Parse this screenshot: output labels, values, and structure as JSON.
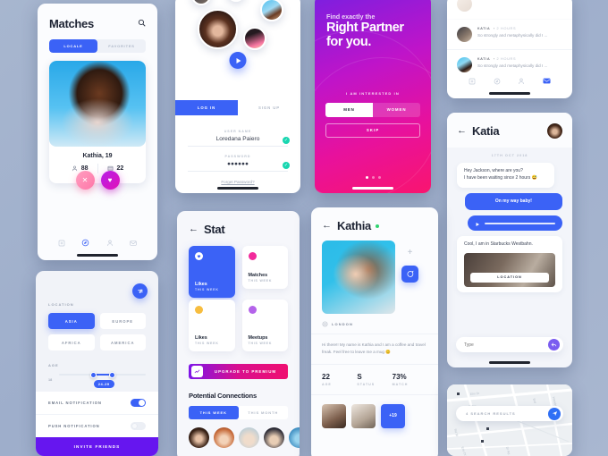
{
  "screens": {
    "matches": {
      "title": "Matches",
      "search_icon": "search-icon",
      "tabs": [
        {
          "label": "LOCALE",
          "active": true
        },
        {
          "label": "FAVORITES",
          "active": false
        }
      ],
      "card": {
        "name": "Kathia, 19",
        "stat_people": "88",
        "stat_cards": "22",
        "reject_icon": "close-icon",
        "like_icon": "heart-icon"
      },
      "nav": [
        {
          "icon": "plus-box-icon",
          "active": false
        },
        {
          "icon": "compass-icon",
          "active": true
        },
        {
          "icon": "person-icon",
          "active": false
        },
        {
          "icon": "mail-icon",
          "active": false
        }
      ]
    },
    "login": {
      "play_icon": "play-icon",
      "tabs": [
        {
          "label": "LOG IN",
          "active": true
        },
        {
          "label": "SIGN UP",
          "active": false
        }
      ],
      "username": {
        "label": "USER NAME",
        "value": "Loredana Paiero",
        "valid_icon": "check-icon"
      },
      "password": {
        "label": "PASSWORD",
        "value": "●●●●●●",
        "valid_icon": "check-icon"
      },
      "forgot": "Forget Password?"
    },
    "onboarding": {
      "eyebrow": "Find exactly the",
      "headline_line1": "Right Partner",
      "headline_line2": "for you.",
      "interest_label": "I AM INTERESTED IN",
      "options": [
        {
          "label": "MEN",
          "active": true
        },
        {
          "label": "WOMEN",
          "active": false
        }
      ],
      "skip_label": "SKIP",
      "page_dots": 3,
      "active_dot": 0,
      "accent_start": "#7b1fe0",
      "accent_end": "#f9156f"
    },
    "chat_list": {
      "messages": [
        {
          "name": "KATIA",
          "time": "2 HOURS",
          "preview": "So strongly and metaphysically did I ..."
        },
        {
          "name": "KATIA",
          "time": "2 HOURS",
          "preview": "So strongly and metaphysically did I ..."
        }
      ],
      "nav": [
        {
          "icon": "plus-box-icon",
          "active": false
        },
        {
          "icon": "compass-icon",
          "active": false
        },
        {
          "icon": "person-icon",
          "active": false
        },
        {
          "icon": "mail-icon",
          "active": true
        }
      ]
    },
    "chat": {
      "back_icon": "back-arrow-icon",
      "title": "Katia",
      "avatar": "contact-avatar",
      "date": "17TH OCT 2018",
      "bubbles": [
        {
          "from": "them",
          "text": "Hey Jackson, where are you?\nI have been waiting since 2 hours 😅"
        },
        {
          "from": "me",
          "text": "On my way baby!"
        },
        {
          "from": "me",
          "type": "voice",
          "play_icon": "play-icon"
        },
        {
          "from": "them",
          "text": "Cool, I am in Starbucks Westbahn.",
          "attachment_button": "LOCATION"
        }
      ],
      "input_placeholder": "Type",
      "send_icon": "send-icon"
    },
    "settings": {
      "filter_icon": "filter-icon",
      "location_label": "LOCATION",
      "locations": [
        {
          "label": "ASIA",
          "active": true
        },
        {
          "label": "EUROPE",
          "active": false
        },
        {
          "label": "AFRICA",
          "active": false
        },
        {
          "label": "AMERICA",
          "active": false
        }
      ],
      "age_label": "AGE",
      "age_min": "18",
      "age_range": "24-29",
      "toggles": [
        {
          "label": "EMAIL NOTIFICATION",
          "on": true
        },
        {
          "label": "PUSH NOTIFICATION",
          "on": false
        }
      ],
      "invite_label": "INVITE FRIENDS"
    },
    "stat": {
      "back_icon": "back-arrow-icon",
      "title": "Stat",
      "cards": [
        {
          "name": "Likes",
          "sub": "THIS WEEK",
          "color": "#ffffff",
          "active": true
        },
        {
          "name": "Matches",
          "sub": "THIS WEEK",
          "color": "#f22a9b",
          "active": false
        },
        {
          "name": "Likes",
          "sub": "THIS WEEK",
          "color": "#f7bd3f",
          "active": false
        },
        {
          "name": "Meetups",
          "sub": "THIS WEEK",
          "color": "#b463ea",
          "active": false
        }
      ],
      "upgrade": {
        "icon": "chart-icon",
        "label": "UPGRADE TO PREMIUM"
      },
      "potential_title": "Potential Connections",
      "potential_tabs": [
        {
          "label": "THIS WEEK",
          "active": true
        },
        {
          "label": "THIS MONTH",
          "active": false
        }
      ]
    },
    "profile": {
      "back_icon": "back-arrow-icon",
      "name": "Kathia",
      "online": true,
      "add_icon": "plus-icon",
      "message_icon": "chat-icon",
      "location_icon": "location-pin-icon",
      "location": "LONDON",
      "bio": "Hi there!! My name is Kathia and I am a coffee and travel freak. Feel free to leave me a mug 😊",
      "stats": [
        {
          "value": "22",
          "label": "AGE"
        },
        {
          "value": "S",
          "label": "STATUS"
        },
        {
          "value": "73%",
          "label": "MATCH"
        }
      ],
      "more_photos": "+19"
    },
    "map": {
      "search_text": "4 SEARCH RESULTS",
      "locate_icon": "navigate-icon"
    }
  }
}
